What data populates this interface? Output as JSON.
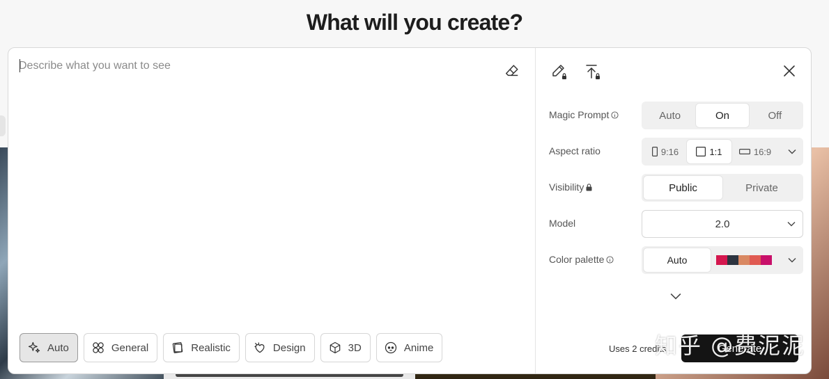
{
  "page": {
    "title": "What will you create?"
  },
  "prompt": {
    "placeholder": "Describe what you want to see",
    "value": ""
  },
  "style_buttons": [
    {
      "label": "Auto",
      "icon": "sparkle-icon",
      "active": true
    },
    {
      "label": "General",
      "icon": "grid-icon",
      "active": false
    },
    {
      "label": "Realistic",
      "icon": "photo-stack-icon",
      "active": false
    },
    {
      "label": "Design",
      "icon": "design-icon",
      "active": false
    },
    {
      "label": "3D",
      "icon": "cube-icon",
      "active": false
    },
    {
      "label": "Anime",
      "icon": "face-icon",
      "active": false
    }
  ],
  "settings": {
    "magic_prompt": {
      "label": "Magic Prompt",
      "options": [
        "Auto",
        "On",
        "Off"
      ],
      "selected": "On"
    },
    "aspect_ratio": {
      "label": "Aspect ratio",
      "options": [
        "9:16",
        "1:1",
        "16:9"
      ],
      "selected": "1:1"
    },
    "visibility": {
      "label": "Visibility",
      "options": [
        "Public",
        "Private"
      ],
      "selected": "Public"
    },
    "model": {
      "label": "Model",
      "value": "2.0"
    },
    "color_palette": {
      "label": "Color palette",
      "selected": "Auto",
      "swatches": [
        "#d4174e",
        "#2d3440",
        "#d98862",
        "#e05a52",
        "#c8106a"
      ]
    }
  },
  "footer": {
    "credits": "Uses 2 credits",
    "generate_label": "Generate"
  },
  "watermark": "知乎 @费泥泥"
}
